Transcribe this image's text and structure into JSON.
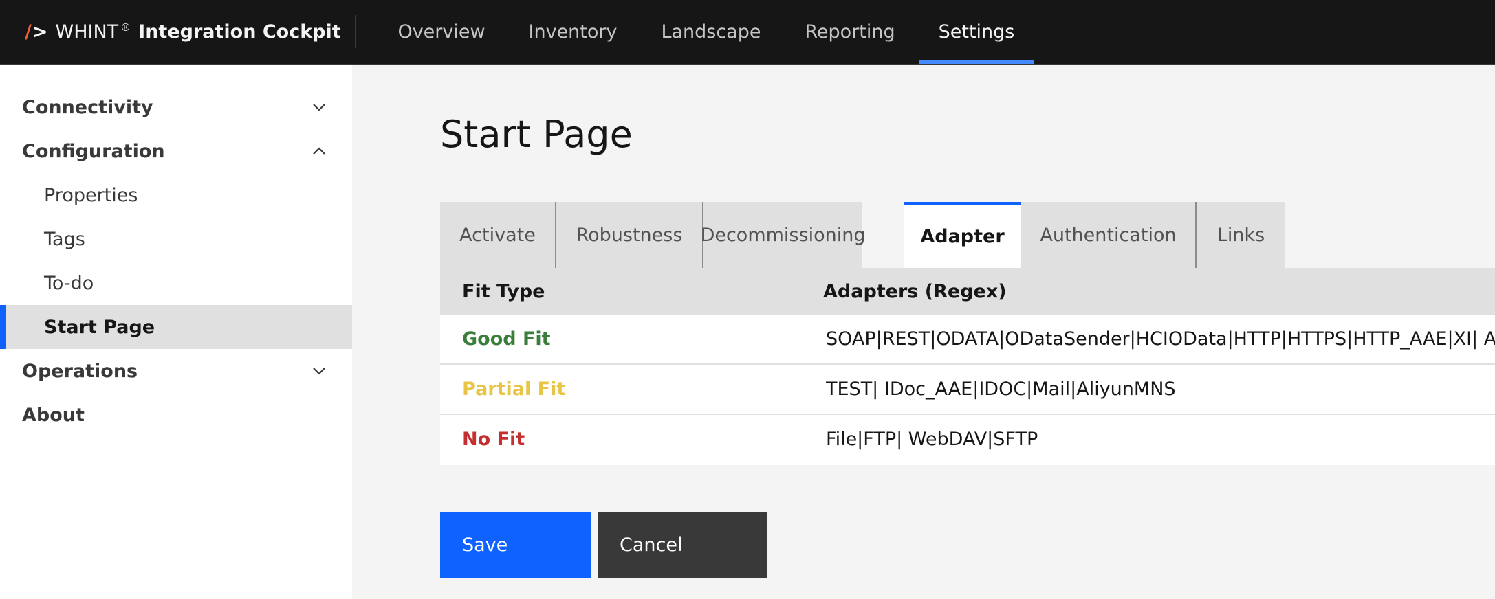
{
  "header": {
    "brand_slash": "/",
    "brand_gt": ">",
    "brand_name": "WHINT",
    "brand_reg": "®",
    "product_name": "Integration Cockpit",
    "nav": [
      {
        "label": "Overview"
      },
      {
        "label": "Inventory"
      },
      {
        "label": "Landscape"
      },
      {
        "label": "Reporting"
      },
      {
        "label": "Settings",
        "active": true
      }
    ]
  },
  "sidebar": {
    "groups": [
      {
        "label": "Connectivity",
        "expanded": false,
        "icon": "chevron-down-icon"
      },
      {
        "label": "Configuration",
        "expanded": true,
        "icon": "chevron-up-icon",
        "items": [
          {
            "label": "Properties"
          },
          {
            "label": "Tags"
          },
          {
            "label": "To-do"
          },
          {
            "label": "Start Page",
            "active": true
          }
        ]
      },
      {
        "label": "Operations",
        "expanded": false,
        "icon": "chevron-down-icon"
      },
      {
        "label": "About"
      }
    ]
  },
  "main": {
    "title": "Start Page",
    "tabs": [
      {
        "label": "Activate"
      },
      {
        "label": "Robustness"
      },
      {
        "label": "Decommissioning"
      },
      {
        "label": "Adapter",
        "active": true
      },
      {
        "label": "Authentication"
      },
      {
        "label": "Links"
      }
    ],
    "table": {
      "headers": [
        "Fit Type",
        "Adapters (Regex)"
      ],
      "rows": [
        {
          "fit": "Good Fit",
          "color": "#3b7d3b",
          "regex": "SOAP|REST|ODATA|ODataSender|HCIOData|HTTP|HTTPS|HTTP_AAE|XI| Az"
        },
        {
          "fit": "Partial Fit",
          "color": "#e8c547",
          "regex": "TEST| IDoc_AAE|IDOC|Mail|AliyunMNS"
        },
        {
          "fit": "No Fit",
          "color": "#c62f2f",
          "regex": "File|FTP| WebDAV|SFTP"
        }
      ]
    },
    "buttons": {
      "save": "Save",
      "cancel": "Cancel"
    }
  },
  "colors": {
    "accent": "#0f62fe",
    "topbar": "#161616",
    "good": "#3b7d3b",
    "partial": "#e8c547",
    "none": "#c62f2f"
  }
}
